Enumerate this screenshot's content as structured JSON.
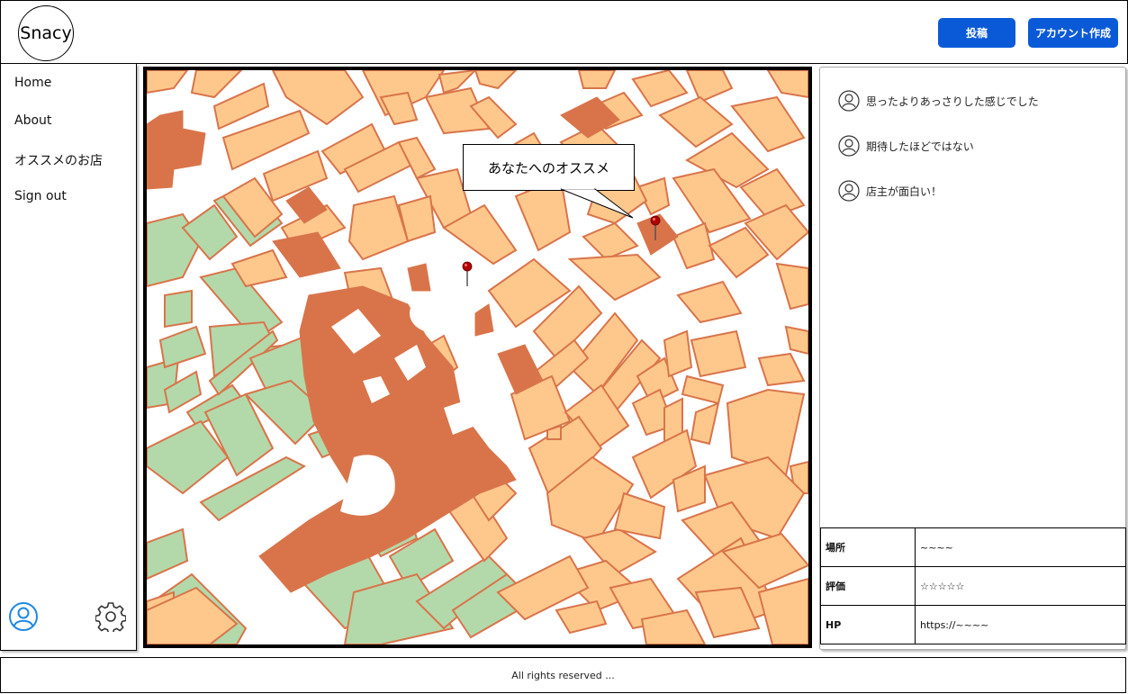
{
  "header": {
    "logo": "Snacy",
    "post_button": "投稿",
    "account_button": "アカウント作成"
  },
  "sidebar": {
    "items": [
      {
        "label": "Home"
      },
      {
        "label": "About"
      },
      {
        "label": "オススメのお店"
      },
      {
        "label": "Sign out"
      }
    ],
    "bottom_icons": [
      "user-icon",
      "gear-icon"
    ]
  },
  "map": {
    "callout": "あなたへのオススメ",
    "pins": [
      "recommended-pin",
      "store-pin"
    ],
    "colors": {
      "building": "#fec88c",
      "building_stroke": "#d9744a",
      "landmark": "#d9744a",
      "park": "#b3d9aa",
      "park_stroke": "#d9744a",
      "road": "#ffffff"
    }
  },
  "reviews": {
    "comments": [
      {
        "text": "思ったよりあっさりした感じでした",
        "icon": "user-icon"
      },
      {
        "text": "期待したほどではない",
        "icon": "user-icon"
      },
      {
        "text": "店主が面白い！",
        "icon": "user-icon"
      }
    ],
    "info": [
      {
        "key": "場所",
        "value": "~~~~"
      },
      {
        "key": "評価",
        "value": "☆☆☆☆☆"
      },
      {
        "key": "HP",
        "value": "https://~~~~"
      }
    ]
  },
  "footer": {
    "text": "All rights reserved ..."
  },
  "colors": {
    "accent": "#0a5ad8",
    "icon_blue": "#1e88e5"
  }
}
